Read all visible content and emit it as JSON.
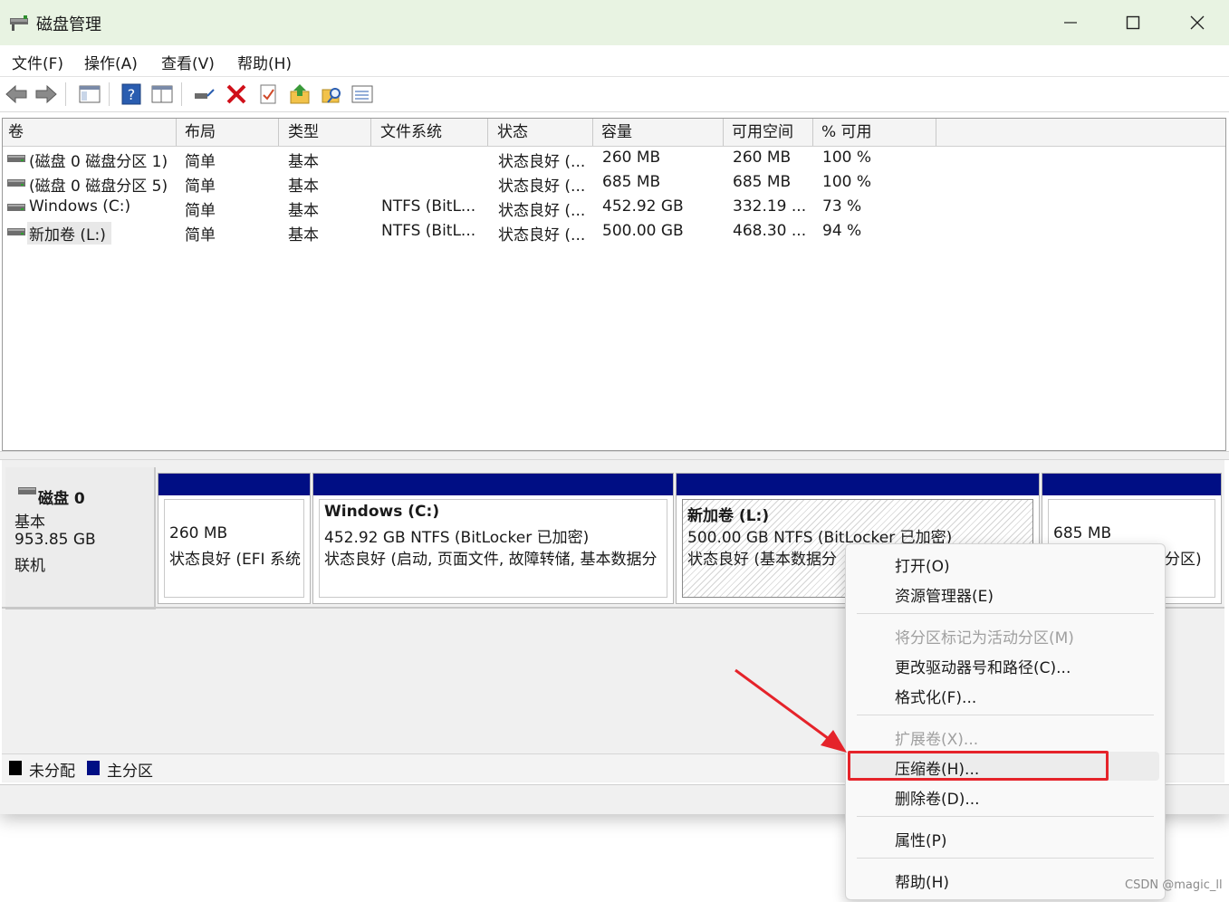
{
  "window": {
    "title": "磁盘管理"
  },
  "menu": [
    "文件(F)",
    "操作(A)",
    "查看(V)",
    "帮助(H)"
  ],
  "toolbar": {
    "icons": [
      "back-arrow-icon",
      "forward-arrow-icon",
      "console-tree-icon",
      "help-icon",
      "show-hide-icon",
      "connect-icon",
      "delete-icon",
      "properties-check-icon",
      "export-icon",
      "search-folder-icon",
      "list-view-icon"
    ]
  },
  "volume_list": {
    "headers": [
      "卷",
      "布局",
      "类型",
      "文件系统",
      "状态",
      "容量",
      "可用空间",
      "% 可用"
    ],
    "rows": [
      {
        "name": "(磁盘 0 磁盘分区 1)",
        "layout": "简单",
        "type": "基本",
        "fs": "",
        "status": "状态良好 (...",
        "capacity": "260 MB",
        "free": "260 MB",
        "pct": "100 %"
      },
      {
        "name": "(磁盘 0 磁盘分区 5)",
        "layout": "简单",
        "type": "基本",
        "fs": "",
        "status": "状态良好 (...",
        "capacity": "685 MB",
        "free": "685 MB",
        "pct": "100 %"
      },
      {
        "name": "Windows (C:)",
        "layout": "简单",
        "type": "基本",
        "fs": "NTFS (BitL...",
        "status": "状态良好 (...",
        "capacity": "452.92 GB",
        "free": "332.19 ...",
        "pct": "73 %"
      },
      {
        "name": "新加卷 (L:)",
        "layout": "简单",
        "type": "基本",
        "fs": "NTFS (BitL...",
        "status": "状态良好 (...",
        "capacity": "500.00 GB",
        "free": "468.30 ...",
        "pct": "94 %"
      }
    ]
  },
  "disk": {
    "name": "磁盘 0",
    "kind": "基本",
    "size": "953.85 GB",
    "state": "联机"
  },
  "partitions": [
    {
      "title": "",
      "line1": "260 MB",
      "line2": "状态良好 (EFI 系统"
    },
    {
      "title": "Windows  (C:)",
      "line1": "452.92 GB NTFS (BitLocker 已加密)",
      "line2": "状态良好 (启动, 页面文件, 故障转储, 基本数据分"
    },
    {
      "title": "新加卷  (L:)",
      "line1": "500.00 GB NTFS (BitLocker 已加密)",
      "line2": "状态良好 (基本数据分"
    },
    {
      "title": "",
      "line1": "685 MB",
      "line2": "分区)"
    }
  ],
  "legend": [
    {
      "label": "未分配",
      "color": "#000000"
    },
    {
      "label": "主分区",
      "color": "#000e84"
    }
  ],
  "context_menu": {
    "open": "打开(O)",
    "explore": "资源管理器(E)",
    "mark_active": "将分区标记为活动分区(M)",
    "change_letter": "更改驱动器号和路径(C)...",
    "format": "格式化(F)...",
    "extend": "扩展卷(X)...",
    "shrink": "压缩卷(H)...",
    "delete": "删除卷(D)...",
    "properties": "属性(P)",
    "help": "帮助(H)"
  },
  "watermark": "CSDN @magic_ll",
  "colors": {
    "partition_bar": "#000e84",
    "titlebar": "#e8f3e2",
    "highlight_box": "#e5232a"
  }
}
